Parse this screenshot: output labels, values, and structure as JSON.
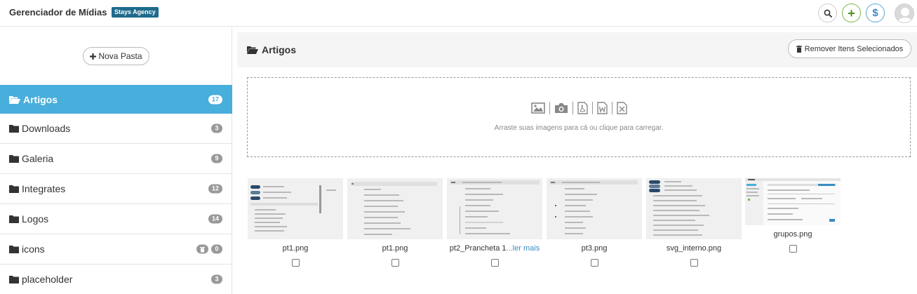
{
  "header": {
    "title": "Gerenciador de Mídias",
    "badge": "Stays Agency",
    "plus_glyph": "+",
    "money_glyph": "$",
    "icons": [
      "search-icon",
      "add-icon",
      "dollar-icon",
      "avatar"
    ]
  },
  "sidebar": {
    "new_folder_label": "Nova Pasta",
    "folders": [
      {
        "name": "Artigos",
        "count": "17",
        "active": true
      },
      {
        "name": "Downloads",
        "count": "3"
      },
      {
        "name": "Galeria",
        "count": "9"
      },
      {
        "name": "Integrates",
        "count": "12"
      },
      {
        "name": "Logos",
        "count": "14"
      },
      {
        "name": "icons",
        "count": "0"
      },
      {
        "name": "placeholder",
        "count": "3"
      }
    ]
  },
  "main": {
    "title": "Artigos",
    "remove_label": "Remover Itens Selecionados",
    "dropzone_text": "Arraste suas imagens para cá ou clique para carregar.",
    "files": [
      {
        "name": "pt1.png"
      },
      {
        "name": "pt1.png"
      },
      {
        "name": "pt2_Prancheta 1",
        "more": "...ler mais"
      },
      {
        "name": "pt3.png"
      },
      {
        "name": "svg_interno.png"
      },
      {
        "name": "grupos.png"
      }
    ]
  },
  "colors": {
    "active_folder": "#48aedb",
    "brand_badge": "#1e6a8d",
    "plus_green": "#4b8f1f",
    "money_blue": "#3b8cc4"
  }
}
